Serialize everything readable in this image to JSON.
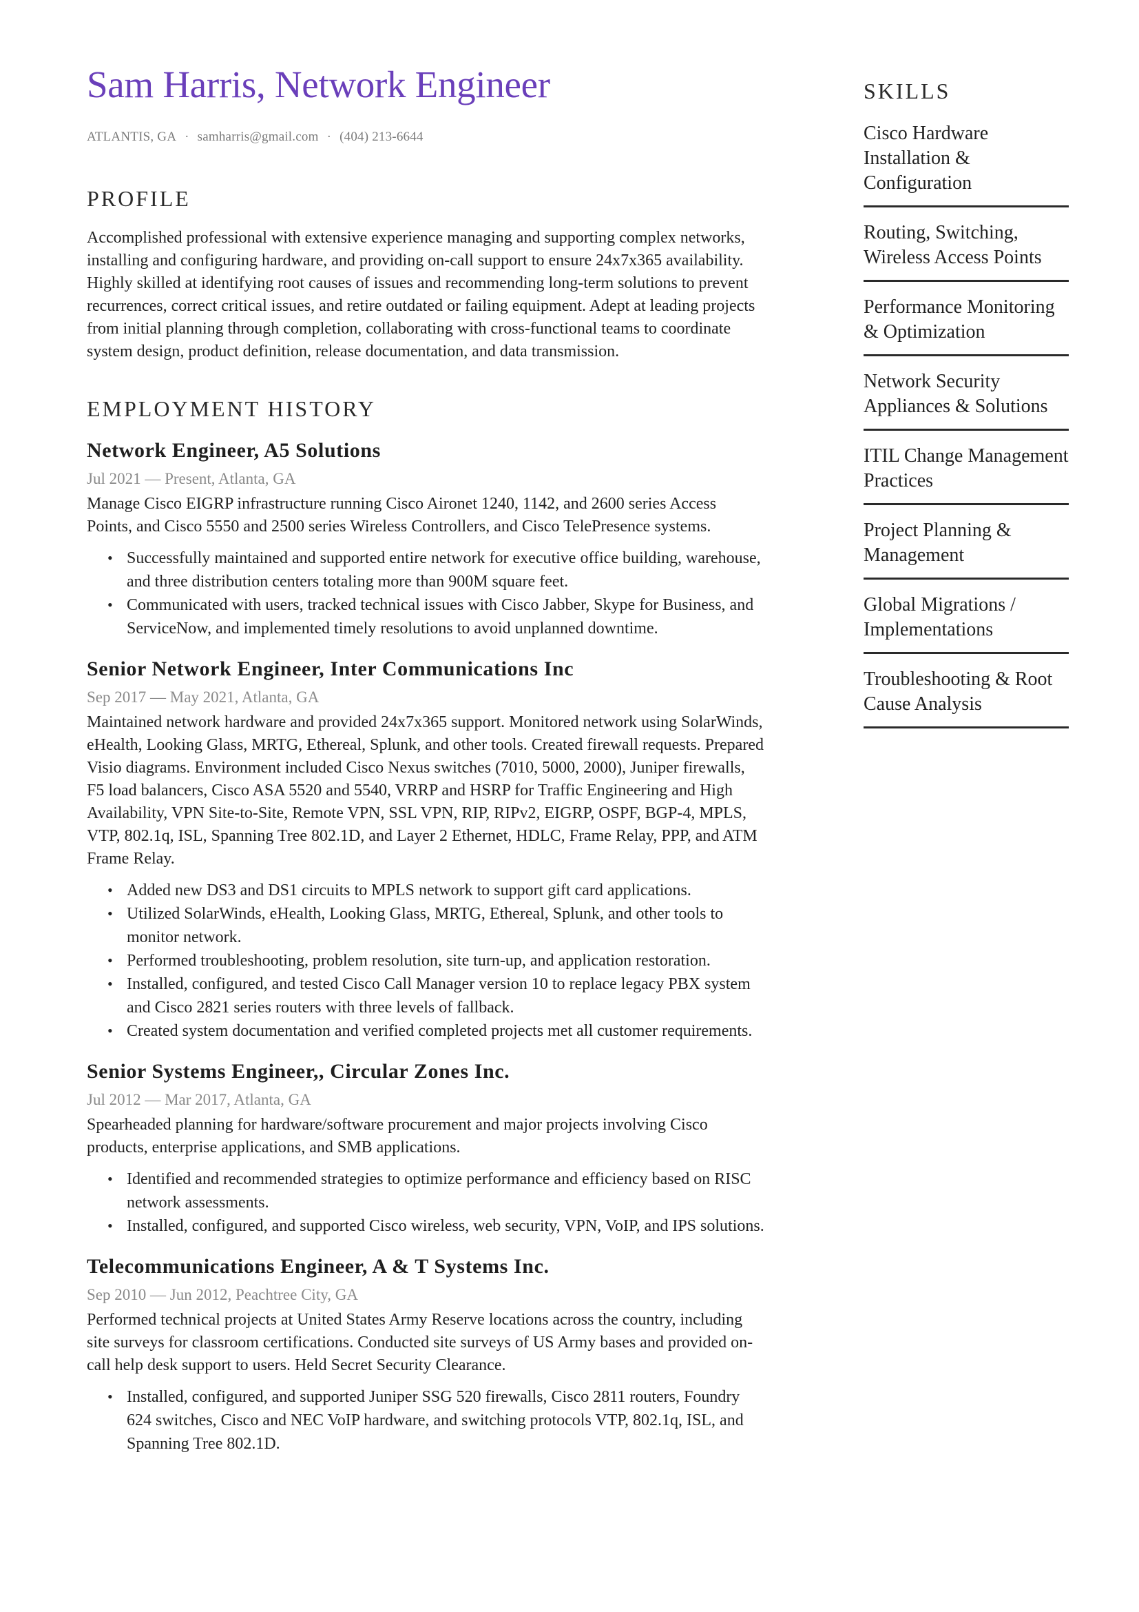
{
  "header": {
    "title": "Sam Harris, Network Engineer",
    "location": "ATLANTIS, GA",
    "email": "samharris@gmail.com",
    "phone": "(404) 213-6644",
    "separator": "·"
  },
  "colors": {
    "accent": "#6a3fba",
    "text": "#1f1f1f",
    "muted": "#8a8a8a"
  },
  "profile": {
    "heading": "PROFILE",
    "text": "Accomplished professional with extensive experience managing and supporting complex networks, installing and configuring hardware, and providing on-call support to ensure 24x7x365 availability. Highly skilled at identifying root causes of issues and recommending long-term solutions to prevent recurrences, correct critical issues, and retire outdated or failing equipment. Adept at leading projects from initial planning through completion, collaborating with cross-functional teams to coordinate system design, product definition, release documentation, and data transmission."
  },
  "employment": {
    "heading": "EMPLOYMENT HISTORY",
    "jobs": [
      {
        "title": "Network Engineer, A5 Solutions",
        "dates": "Jul 2021 — Present, Atlanta, GA",
        "description": "Manage Cisco EIGRP infrastructure running Cisco Aironet 1240, 1142, and 2600 series Access Points, and Cisco 5550 and 2500 series Wireless Controllers, and Cisco TelePresence systems.",
        "bullets": [
          "Successfully maintained and supported entire network for executive office building, warehouse, and three distribution centers totaling more than 900M square feet.",
          "Communicated with users, tracked technical issues with Cisco Jabber, Skype for Business, and ServiceNow, and implemented timely resolutions to avoid unplanned downtime."
        ]
      },
      {
        "title": "Senior Network Engineer, Inter Communications Inc",
        "dates": "Sep 2017 — May 2021, Atlanta, GA",
        "description": "Maintained network hardware and provided 24x7x365 support. Monitored network using SolarWinds, eHealth, Looking Glass, MRTG, Ethereal, Splunk, and other tools. Created firewall requests. Prepared Visio diagrams. Environment included Cisco Nexus switches (7010, 5000, 2000), Juniper firewalls, F5 load balancers, Cisco ASA 5520 and 5540, VRRP and HSRP for Traffic Engineering and High Availability, VPN Site-to-Site, Remote VPN, SSL VPN, RIP, RIPv2, EIGRP, OSPF, BGP-4, MPLS, VTP, 802.1q, ISL, Spanning Tree 802.1D, and Layer 2 Ethernet, HDLC, Frame Relay, PPP, and ATM Frame Relay.",
        "bullets": [
          "Added new DS3 and DS1 circuits to MPLS network to support gift card applications.",
          "Utilized SolarWinds, eHealth, Looking Glass, MRTG, Ethereal, Splunk, and other tools to monitor network.",
          "Performed troubleshooting, problem resolution, site turn-up, and application restoration.",
          "Installed, configured, and tested Cisco Call Manager version 10 to replace legacy PBX system and Cisco 2821 series routers with three levels of fallback.",
          "Created system documentation and verified completed projects met all customer requirements."
        ]
      },
      {
        "title": "Senior Systems Engineer,, Circular Zones Inc.",
        "dates": "Jul 2012 — Mar 2017, Atlanta, GA",
        "description": "Spearheaded planning for hardware/software procurement and major projects involving Cisco products, enterprise applications, and SMB applications.",
        "bullets": [
          "Identified and recommended strategies to optimize performance and efficiency based on RISC network assessments.",
          "Installed, configured, and supported Cisco wireless, web security, VPN, VoIP, and IPS solutions."
        ]
      },
      {
        "title": "Telecommunications Engineer, A & T Systems Inc.",
        "dates": "Sep 2010 — Jun 2012, Peachtree City, GA",
        "description": "Performed technical projects at United States Army Reserve locations across the country, including site surveys for classroom certifications. Conducted site surveys of US Army bases and provided on-call help desk support to users. Held Secret Security Clearance.",
        "bullets": [
          "Installed, configured, and supported Juniper SSG 520 firewalls, Cisco 2811 routers, Foundry 624 switches, Cisco and NEC VoIP hardware, and switching protocols VTP, 802.1q, ISL, and Spanning Tree 802.1D."
        ]
      }
    ]
  },
  "skills": {
    "heading": "SKILLS",
    "items": [
      "Cisco Hardware Installation & Configuration",
      "Routing, Switching, Wireless Access Points",
      "Performance Monitoring & Optimization",
      "Network Security Appliances & Solutions",
      "ITIL Change Management Practices",
      "Project Planning & Management",
      "Global Migrations / Implementations",
      "Troubleshooting & Root Cause Analysis"
    ]
  }
}
